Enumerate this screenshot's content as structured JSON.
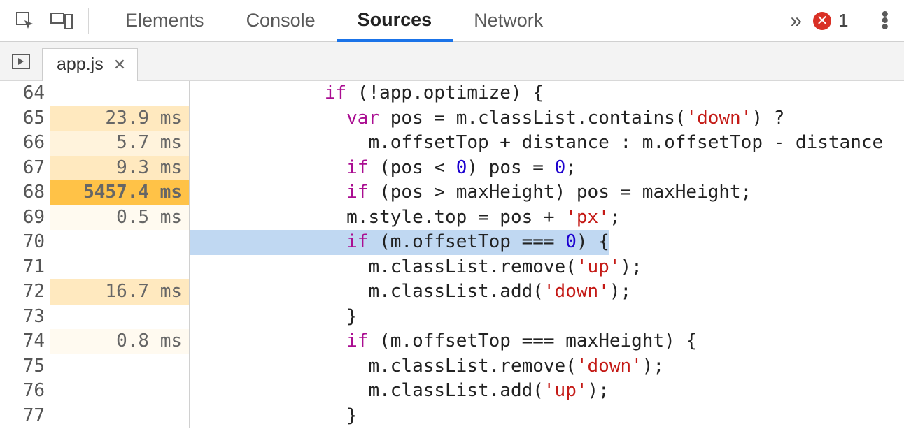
{
  "toolbar": {
    "tabs": [
      "Elements",
      "Console",
      "Sources",
      "Network"
    ],
    "active_tab": "Sources",
    "error_count": "1"
  },
  "file_tab": {
    "name": "app.js"
  },
  "lines": [
    {
      "num": "64",
      "time": "",
      "shade": "t0",
      "exec_hl": false,
      "code": [
        {
          "t": "pln",
          "v": "            "
        },
        {
          "t": "kw",
          "v": "if"
        },
        {
          "t": "pln",
          "v": " (!app.optimize) {"
        }
      ]
    },
    {
      "num": "65",
      "time": "23.9 ms",
      "shade": "t3",
      "exec_hl": false,
      "code": [
        {
          "t": "pln",
          "v": "              "
        },
        {
          "t": "kw",
          "v": "var"
        },
        {
          "t": "pln",
          "v": " pos = m.classList.contains("
        },
        {
          "t": "str",
          "v": "'down'"
        },
        {
          "t": "pln",
          "v": ") ?"
        }
      ]
    },
    {
      "num": "66",
      "time": "5.7 ms",
      "shade": "t2",
      "exec_hl": false,
      "code": [
        {
          "t": "pln",
          "v": "                m.offsetTop + distance : m.offsetTop - distance"
        }
      ]
    },
    {
      "num": "67",
      "time": "9.3 ms",
      "shade": "t3",
      "exec_hl": false,
      "code": [
        {
          "t": "pln",
          "v": "              "
        },
        {
          "t": "kw",
          "v": "if"
        },
        {
          "t": "pln",
          "v": " (pos < "
        },
        {
          "t": "num",
          "v": "0"
        },
        {
          "t": "pln",
          "v": ") pos = "
        },
        {
          "t": "num",
          "v": "0"
        },
        {
          "t": "pln",
          "v": ";"
        }
      ]
    },
    {
      "num": "68",
      "time": "5457.4 ms",
      "shade": "t5",
      "exec_hl": false,
      "code": [
        {
          "t": "pln",
          "v": "              "
        },
        {
          "t": "kw",
          "v": "if"
        },
        {
          "t": "pln",
          "v": " (pos > maxHeight) pos = maxHeight;"
        }
      ]
    },
    {
      "num": "69",
      "time": "0.5 ms",
      "shade": "t1",
      "exec_hl": false,
      "code": [
        {
          "t": "pln",
          "v": "              m.style.top = pos + "
        },
        {
          "t": "str",
          "v": "'px'"
        },
        {
          "t": "pln",
          "v": ";"
        }
      ]
    },
    {
      "num": "70",
      "time": "",
      "shade": "t0",
      "exec_hl": true,
      "code": [
        {
          "t": "pln",
          "v": "              "
        },
        {
          "t": "kw",
          "v": "if"
        },
        {
          "t": "pln",
          "v": " (m.offsetTop === "
        },
        {
          "t": "num",
          "v": "0"
        },
        {
          "t": "pln",
          "v": ") {"
        }
      ]
    },
    {
      "num": "71",
      "time": "",
      "shade": "t0",
      "exec_hl": false,
      "code": [
        {
          "t": "pln",
          "v": "                m.classList.remove("
        },
        {
          "t": "str",
          "v": "'up'"
        },
        {
          "t": "pln",
          "v": ");"
        }
      ]
    },
    {
      "num": "72",
      "time": "16.7 ms",
      "shade": "t3",
      "exec_hl": false,
      "code": [
        {
          "t": "pln",
          "v": "                m.classList.add("
        },
        {
          "t": "str",
          "v": "'down'"
        },
        {
          "t": "pln",
          "v": ");"
        }
      ]
    },
    {
      "num": "73",
      "time": "",
      "shade": "t0",
      "exec_hl": false,
      "code": [
        {
          "t": "pln",
          "v": "              }"
        }
      ]
    },
    {
      "num": "74",
      "time": "0.8 ms",
      "shade": "t1",
      "exec_hl": false,
      "code": [
        {
          "t": "pln",
          "v": "              "
        },
        {
          "t": "kw",
          "v": "if"
        },
        {
          "t": "pln",
          "v": " (m.offsetTop === maxHeight) {"
        }
      ]
    },
    {
      "num": "75",
      "time": "",
      "shade": "t0",
      "exec_hl": false,
      "code": [
        {
          "t": "pln",
          "v": "                m.classList.remove("
        },
        {
          "t": "str",
          "v": "'down'"
        },
        {
          "t": "pln",
          "v": ");"
        }
      ]
    },
    {
      "num": "76",
      "time": "",
      "shade": "t0",
      "exec_hl": false,
      "code": [
        {
          "t": "pln",
          "v": "                m.classList.add("
        },
        {
          "t": "str",
          "v": "'up'"
        },
        {
          "t": "pln",
          "v": ");"
        }
      ]
    },
    {
      "num": "77",
      "time": "",
      "shade": "t0",
      "exec_hl": false,
      "code": [
        {
          "t": "pln",
          "v": "              }"
        }
      ]
    }
  ]
}
